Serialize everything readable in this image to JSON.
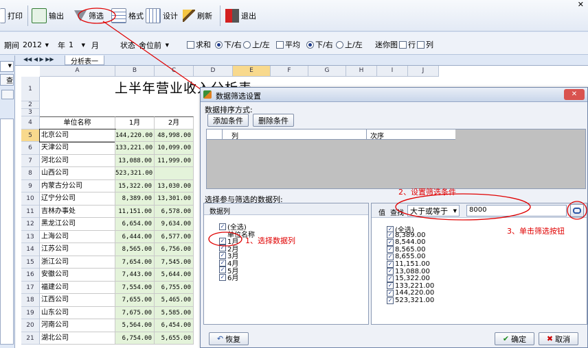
{
  "toolbar": {
    "print": "打印",
    "export": "输出",
    "filter": "筛选",
    "format": "格式",
    "design": "设计",
    "refresh": "刷新",
    "exit": "退出"
  },
  "params": {
    "period_label": "期间",
    "period_value": "2012",
    "year_label": "年",
    "month_value": "1",
    "month_label": "月",
    "state_label": "状态",
    "state_value": "舍位前",
    "sum_label": "求和",
    "down_right": "下/右",
    "up_left": "上/左",
    "avg_label": "平均",
    "down_right2": "下/右",
    "up_left2": "上/左",
    "mini_label": "迷你图",
    "row_label": "行",
    "col_label": "列"
  },
  "left": {
    "query": "查询"
  },
  "sheet": {
    "tab": "分析表一",
    "title": "上半年营业收入分析表",
    "columns": [
      "A",
      "B",
      "C",
      "D",
      "E",
      "F",
      "G",
      "H",
      "I",
      "J"
    ],
    "header": [
      "单位名称",
      "1月",
      "2月"
    ],
    "rows": [
      {
        "n": "1"
      },
      {
        "n": "2"
      },
      {
        "n": "3"
      },
      {
        "n": "4"
      },
      {
        "n": "5",
        "name": "北京公司",
        "m1": "144,220.00",
        "m2": "48,998.00"
      },
      {
        "n": "6",
        "name": "天津公司",
        "m1": "133,221.00",
        "m2": "10,099.00"
      },
      {
        "n": "7",
        "name": "河北公司",
        "m1": "13,088.00",
        "m2": "11,999.00"
      },
      {
        "n": "8",
        "name": "山西公司",
        "m1": "523,321.00",
        "m2": ""
      },
      {
        "n": "9",
        "name": "内蒙古分公司",
        "m1": "15,322.00",
        "m2": "13,030.00"
      },
      {
        "n": "10",
        "name": "辽宁分公司",
        "m1": "8,389.00",
        "m2": "13,301.00"
      },
      {
        "n": "11",
        "name": "吉林办事处",
        "m1": "11,151.00",
        "m2": "6,578.00"
      },
      {
        "n": "12",
        "name": "黑龙江公司",
        "m1": "6,654.00",
        "m2": "9,634.00"
      },
      {
        "n": "13",
        "name": "上海公司",
        "m1": "6,444.00",
        "m2": "6,577.00"
      },
      {
        "n": "14",
        "name": "江苏公司",
        "m1": "8,565.00",
        "m2": "6,756.00"
      },
      {
        "n": "15",
        "name": "浙江公司",
        "m1": "7,654.00",
        "m2": "7,545.00"
      },
      {
        "n": "16",
        "name": "安徽公司",
        "m1": "7,443.00",
        "m2": "5,644.00"
      },
      {
        "n": "17",
        "name": "福建公司",
        "m1": "7,554.00",
        "m2": "6,755.00"
      },
      {
        "n": "18",
        "name": "江西公司",
        "m1": "7,655.00",
        "m2": "5,465.00"
      },
      {
        "n": "19",
        "name": "山东公司",
        "m1": "7,675.00",
        "m2": "5,585.00"
      },
      {
        "n": "20",
        "name": "河南公司",
        "m1": "5,564.00",
        "m2": "6,454.00"
      },
      {
        "n": "21",
        "name": "湖北公司",
        "m1": "6,754.00",
        "m2": "5,655.00"
      }
    ]
  },
  "dialog": {
    "title": "数据筛选设置",
    "sort_label": "数据排序方式:",
    "add_cond": "添加条件",
    "del_cond": "删除条件",
    "grid_col": "列",
    "grid_order": "次序",
    "filter_cols_label": "选择参与筛选的数据列:",
    "data_col_header": "数据列",
    "left_tree": [
      "(全选)",
      "单位名称",
      "1月",
      "2月",
      "3月",
      "4月",
      "5月",
      "6月"
    ],
    "value_label": "值",
    "find_label": "查找",
    "operator": "大于或等于",
    "input_value": "8000",
    "right_tree": [
      "(全选)",
      "8,389.00",
      "8,544.00",
      "8,565.00",
      "8,655.00",
      "11,151.00",
      "13,088.00",
      "15,322.00",
      "133,221.00",
      "144,220.00",
      "523,321.00"
    ],
    "restore": "恢复",
    "ok": "确定",
    "cancel": "取消"
  },
  "annotations": {
    "step1": "1、选择数据列",
    "step2": "2、设置筛选条件",
    "step3": "3、单击筛选按钮"
  },
  "colors": {
    "accent": "#e00000",
    "number_bg": "#e4f3da",
    "selected_header": "#f8d98d"
  }
}
